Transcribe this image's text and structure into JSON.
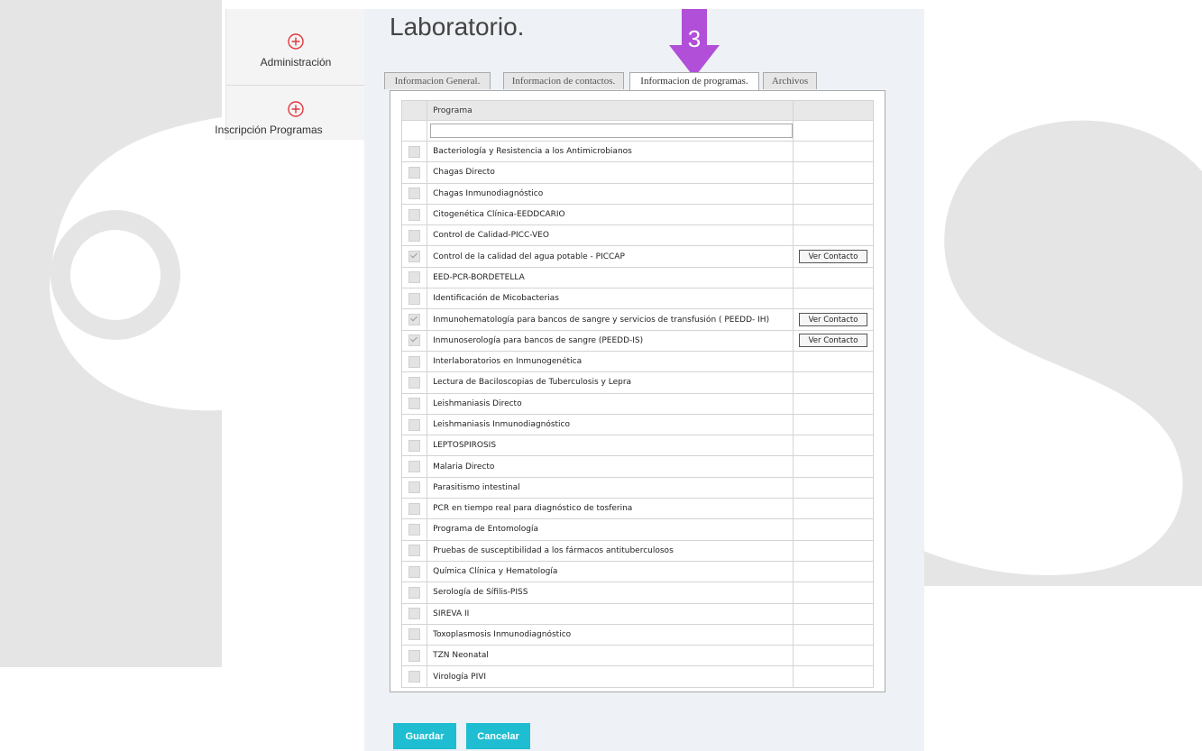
{
  "sidebar": {
    "items": [
      {
        "label": "Administración",
        "icon": "plus-circle-icon"
      },
      {
        "label": "Inscripción Programas",
        "icon": "plus-circle-icon"
      }
    ]
  },
  "page": {
    "title": "Laboratorio."
  },
  "annotation": {
    "number": "3",
    "color": "#b14fd8"
  },
  "tabs": [
    {
      "label": "Informacion General.",
      "active": false
    },
    {
      "label": "Informacion de contactos.",
      "active": false
    },
    {
      "label": "Informacion de programas.",
      "active": true
    },
    {
      "label": "Archivos",
      "active": false
    }
  ],
  "table": {
    "header": "Programa",
    "filter_value": "",
    "rows": [
      {
        "name": "Bacteriología y Resistencia a los Antimicrobianos",
        "checked": false,
        "action": ""
      },
      {
        "name": "Chagas Directo",
        "checked": false,
        "action": ""
      },
      {
        "name": "Chagas Inmunodiagnóstico",
        "checked": false,
        "action": ""
      },
      {
        "name": "Citogenética Clínica-EEDDCARIO",
        "checked": false,
        "action": ""
      },
      {
        "name": "Control de Calidad-PICC-VEO",
        "checked": false,
        "action": ""
      },
      {
        "name": "Control de la calidad del agua potable - PICCAP",
        "checked": true,
        "action": "Ver Contacto"
      },
      {
        "name": "EED-PCR-BORDETELLA",
        "checked": false,
        "action": ""
      },
      {
        "name": "Identificación de Micobacterias",
        "checked": false,
        "action": ""
      },
      {
        "name": "Inmunohematología para bancos de sangre y servicios de transfusión ( PEEDD- IH)",
        "checked": true,
        "action": "Ver Contacto"
      },
      {
        "name": "Inmunoserología para bancos de sangre (PEEDD-IS)",
        "checked": true,
        "action": "Ver Contacto"
      },
      {
        "name": "Interlaboratorios en Inmunogenética",
        "checked": false,
        "action": ""
      },
      {
        "name": "Lectura de Baciloscopias de Tuberculosis y Lepra",
        "checked": false,
        "action": ""
      },
      {
        "name": "Leishmaniasis Directo",
        "checked": false,
        "action": ""
      },
      {
        "name": "Leishmaniasis Inmunodiagnóstico",
        "checked": false,
        "action": ""
      },
      {
        "name": "LEPTOSPIROSIS",
        "checked": false,
        "action": ""
      },
      {
        "name": "Malaria Directo",
        "checked": false,
        "action": ""
      },
      {
        "name": "Parasitismo intestinal",
        "checked": false,
        "action": ""
      },
      {
        "name": "PCR en tiempo real para diagnóstico de tosferina",
        "checked": false,
        "action": ""
      },
      {
        "name": "Programa de Entomología",
        "checked": false,
        "action": ""
      },
      {
        "name": "Pruebas de susceptibilidad a los fármacos antituberculosos",
        "checked": false,
        "action": ""
      },
      {
        "name": "Química Clínica y Hematología",
        "checked": false,
        "action": ""
      },
      {
        "name": "Serología de Sífilis-PISS",
        "checked": false,
        "action": ""
      },
      {
        "name": "SIREVA II",
        "checked": false,
        "action": ""
      },
      {
        "name": "Toxoplasmosis Inmunodiagnóstico",
        "checked": false,
        "action": ""
      },
      {
        "name": "TZN Neonatal",
        "checked": false,
        "action": ""
      },
      {
        "name": "Virología PIVI",
        "checked": false,
        "action": ""
      }
    ]
  },
  "buttons": {
    "save": "Guardar",
    "cancel": "Cancelar"
  },
  "colors": {
    "accent": "#1fbdd1",
    "sidebar_icon": "#e0383e",
    "watermark": "#e5e5e5"
  }
}
